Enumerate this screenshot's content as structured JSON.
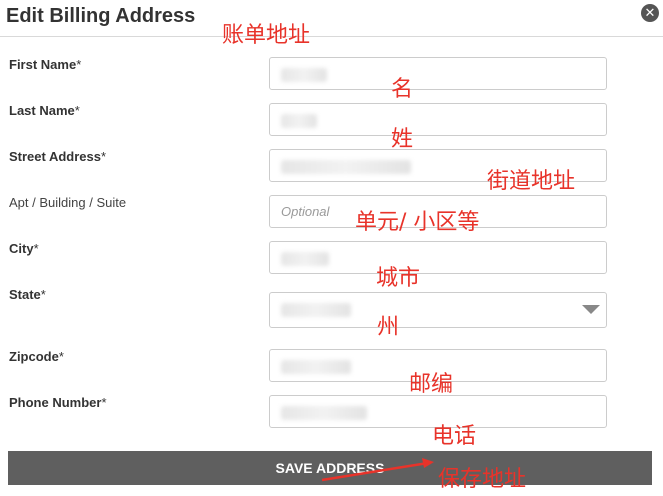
{
  "dialog": {
    "title": "Edit Billing Address",
    "close_icon": "close-icon"
  },
  "fields": [
    {
      "label": "First Name",
      "required": "*",
      "value": "",
      "placeholder": ""
    },
    {
      "label": "Last Name",
      "required": "*",
      "value": "",
      "placeholder": ""
    },
    {
      "label": "Street Address",
      "required": "*",
      "value": "",
      "placeholder": ""
    },
    {
      "label": "Apt / Building / Suite",
      "required": "",
      "value": "",
      "placeholder": "Optional"
    },
    {
      "label": "City",
      "required": "*",
      "value": "",
      "placeholder": ""
    },
    {
      "label": "State",
      "required": "*",
      "value": "",
      "placeholder": ""
    },
    {
      "label": "Zipcode",
      "required": "*",
      "value": "",
      "placeholder": ""
    },
    {
      "label": "Phone Number",
      "required": "*",
      "value": "",
      "placeholder": ""
    }
  ],
  "save_button": "SAVE ADDRESS",
  "annotations": {
    "title": "账单地址",
    "first_name": "名",
    "last_name": "姓",
    "street": "街道地址",
    "apt": "单元/ 小区等",
    "city": "城市",
    "state": "州",
    "zip": "邮编",
    "phone": "电话",
    "save": "保存地址"
  },
  "colors": {
    "annotation": "#e8332a",
    "save_bar": "#5f5f5f",
    "border": "#cccccc"
  }
}
